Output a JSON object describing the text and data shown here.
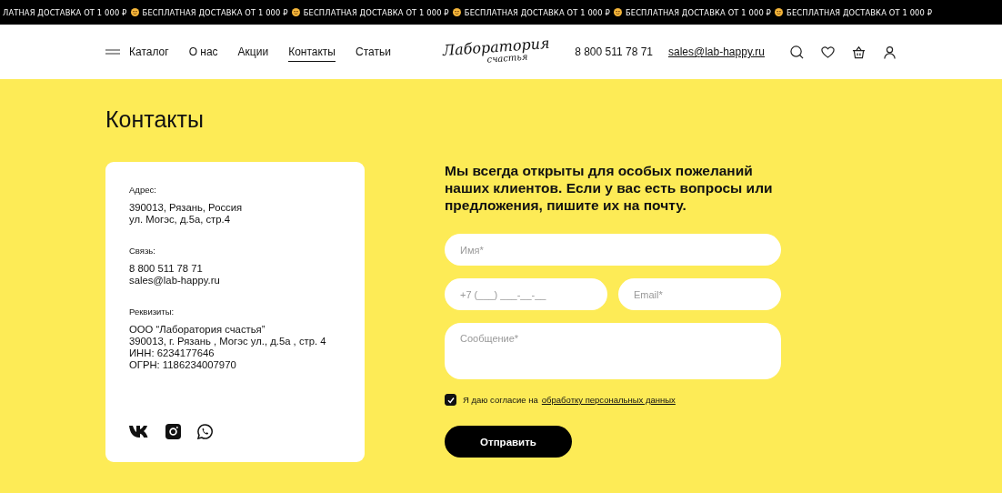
{
  "ticker": [
    "ЛАТНАЯ ДОСТАВКА ОТ 1 000 ₽",
    "БЕСПЛАТНАЯ ДОСТАВКА ОТ 1 000 ₽",
    "БЕСПЛАТНАЯ ДОСТАВКА ОТ 1 000 ₽",
    "БЕСПЛАТНАЯ ДОСТАВКА ОТ 1 000 ₽",
    "БЕСПЛАТНАЯ ДОСТАВКА ОТ 1 000 ₽",
    "БЕСПЛАТНАЯ ДОСТАВКА ОТ 1 000 ₽"
  ],
  "nav": [
    {
      "label": "Каталог",
      "selected": false
    },
    {
      "label": "О нас",
      "selected": false
    },
    {
      "label": "Акции",
      "selected": false
    },
    {
      "label": "Контакты",
      "selected": true
    },
    {
      "label": "Статьи",
      "selected": false
    }
  ],
  "logo": {
    "line_1": "Лаборатория",
    "line_2": "счастья"
  },
  "header_phone": "8 800 511 78 71",
  "header_email": "sales@lab-happy.ru",
  "title": "Контакты",
  "contacts": [
    {
      "label": "Адрес:",
      "lines": [
        "390013, Рязань, Россия",
        "ул. Могэс, д.5а, стр.4"
      ]
    },
    {
      "label": "Связь:",
      "lines": [
        "8 800 511 78 71",
        "sales@lab-happy.ru"
      ]
    },
    {
      "label": "Реквизиты:",
      "lines": [
        "ООО “Лаборатория счастья”",
        "390013, г. Рязань , Могэс ул., д.5а , стр. 4",
        "ИНН: 6234177646",
        "ОГРН: 1186234007970"
      ]
    }
  ],
  "form": {
    "intro": "Мы всегда открыты для особых пожеланий наших клиентов. Если у вас есть вопросы или предложения, пишите их на почту.",
    "name_placeholder": "Имя*",
    "phone_placeholder": "+7 (___) ___-__-__",
    "email_placeholder": "Email*",
    "message_placeholder": "Сообщение*",
    "consent": {
      "checked": true,
      "text": "Я даю согласие на",
      "link": "обработку персональных данных"
    },
    "submit": "Отправить"
  }
}
